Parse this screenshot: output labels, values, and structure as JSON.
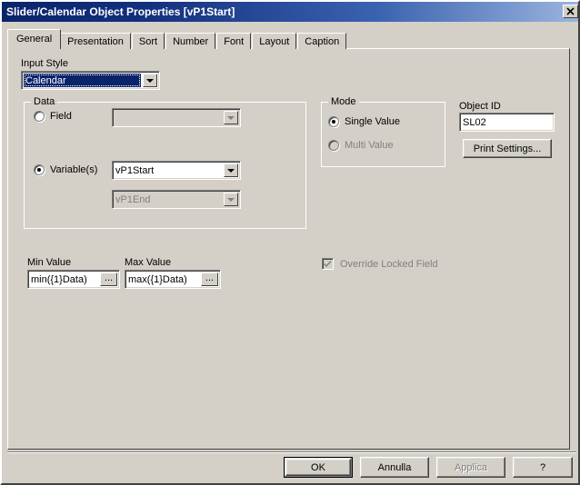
{
  "window": {
    "title": "Slider/Calendar Object Properties [vP1Start]",
    "close_icon": "close-icon"
  },
  "tabs": [
    {
      "label": "General",
      "active": true
    },
    {
      "label": "Presentation",
      "active": false
    },
    {
      "label": "Sort",
      "active": false
    },
    {
      "label": "Number",
      "active": false
    },
    {
      "label": "Font",
      "active": false
    },
    {
      "label": "Layout",
      "active": false
    },
    {
      "label": "Caption",
      "active": false
    }
  ],
  "general": {
    "input_style": {
      "label": "Input Style",
      "value": "Calendar"
    },
    "data_group": {
      "title": "Data",
      "field_radio_label": "Field",
      "field_value": "",
      "variables_radio_label": "Variable(s)",
      "variable_start_value": "vP1Start",
      "variable_end_value": "vP1End"
    },
    "mode_group": {
      "title": "Mode",
      "single_value_label": "Single Value",
      "multi_value_label": "Multi Value"
    },
    "object_id": {
      "label": "Object ID",
      "value": "SL02"
    },
    "print_settings_button": "Print Settings...",
    "min_value": {
      "label": "Min Value",
      "value": "min({1}Data)",
      "browse_label": "..."
    },
    "max_value": {
      "label": "Max Value",
      "value": "max({1}Data)",
      "browse_label": "..."
    },
    "override_locked_field": {
      "label": "Override Locked Field",
      "checked": true,
      "enabled": false
    }
  },
  "footer": {
    "ok": "OK",
    "cancel": "Annulla",
    "apply": "Applica",
    "help": "?"
  },
  "colors": {
    "dialog_face": "#d4d0c8",
    "title_start": "#0a246a",
    "title_end": "#9cb5e0",
    "highlight": "#0a246a",
    "disabled_text": "#808080"
  }
}
